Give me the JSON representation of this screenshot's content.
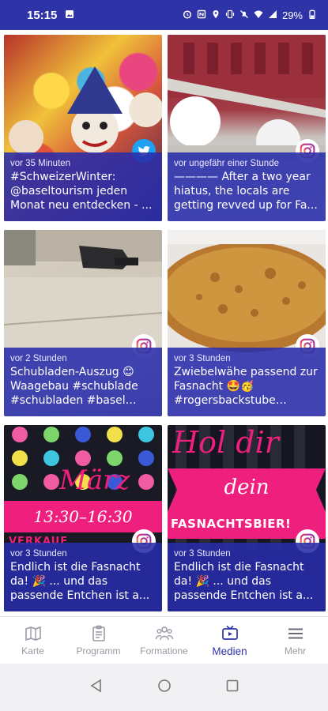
{
  "status_bar": {
    "time": "15:15",
    "battery": "29%"
  },
  "posts": [
    {
      "source": "twitter",
      "source_icon": "twitter-icon",
      "meta": "vor 35 Minuten",
      "text": "#SchweizerWinter: @baseltourism jeden Monat neu entdecken - ..."
    },
    {
      "source": "instagram",
      "source_icon": "instagram-icon",
      "meta": "vor ungefähr einer Stunde",
      "text": "———— After a two year hiatus, the locals are getting revved up for Fa..."
    },
    {
      "source": "instagram",
      "source_icon": "instagram-icon",
      "meta": "vor 2 Stunden",
      "text": "Schubladen-Auszug 😊 Waagebau #schublade #schubladen #basel #b..."
    },
    {
      "source": "instagram",
      "source_icon": "instagram-icon",
      "meta": "vor 3 Stunden",
      "text": "Zwiebelwähe passend zur Fasnacht 🤩🥳 #rogersbackstube #han..."
    },
    {
      "source": "instagram",
      "source_icon": "instagram-icon",
      "meta": "vor 3 Stunden",
      "text": "Endlich ist die Fasnacht da! 🎉 ... und das passende Entchen ist a...",
      "image_text": {
        "line1": "März",
        "line2": "13:30–16:30",
        "line3": "VERKAUF"
      }
    },
    {
      "source": "instagram",
      "source_icon": "instagram-icon",
      "meta": "vor 3 Stunden",
      "text": "Endlich ist die Fasnacht da! 🎉 ... und das passende Entchen ist a...",
      "image_text": {
        "line1": "Hol dir",
        "line2": "dein",
        "line3": "FASNACHTSBIER!"
      }
    }
  ],
  "nav": {
    "items": [
      {
        "label": "Karte",
        "icon": "map-icon",
        "active": false
      },
      {
        "label": "Programm",
        "icon": "clipboard-icon",
        "active": false
      },
      {
        "label": "Formatione",
        "icon": "people-icon",
        "active": false
      },
      {
        "label": "Medien",
        "icon": "tv-icon",
        "active": true
      },
      {
        "label": "Mehr",
        "icon": "menu-icon",
        "active": false
      }
    ]
  },
  "colors": {
    "primary": "#2e33a8",
    "overlay": "#282caa",
    "nav_inactive": "#9a9aa6",
    "twitter": "#1da1f2",
    "pink": "#ee1f7d"
  }
}
